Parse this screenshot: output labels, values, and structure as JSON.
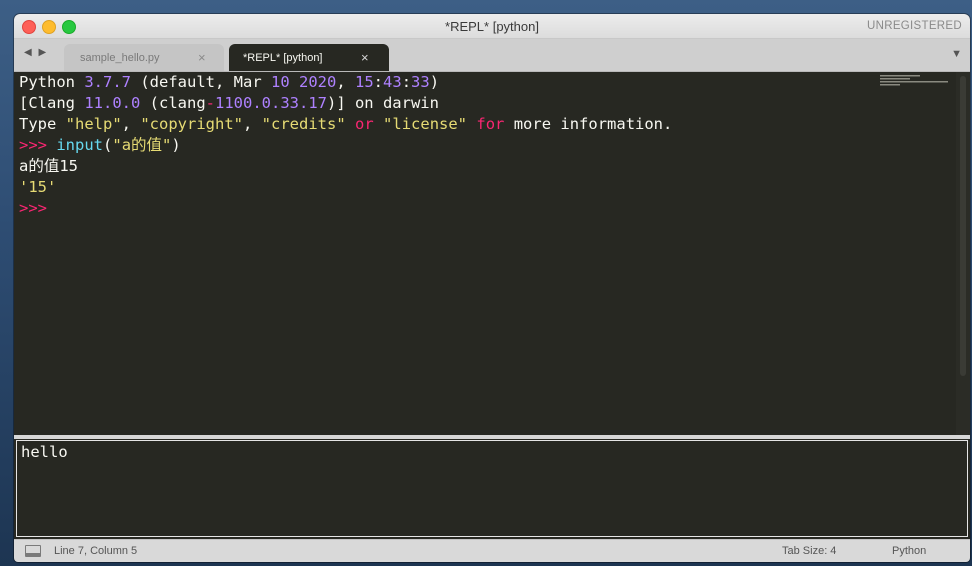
{
  "window": {
    "title": "*REPL* [python]",
    "license_label": "UNREGISTERED"
  },
  "tabs": {
    "nav_arrows": "◀ ▶",
    "items": [
      {
        "label": "sample_hello.py",
        "close": "×",
        "active": false
      },
      {
        "label": "*REPL* [python]",
        "close": "×",
        "active": true
      }
    ],
    "dropdown_icon": "▼"
  },
  "editor": {
    "lines": [
      [
        {
          "t": "Python ",
          "c": ""
        },
        {
          "t": "3.7.7",
          "c": "num"
        },
        {
          "t": " (default, Mar ",
          "c": ""
        },
        {
          "t": "10",
          "c": "num"
        },
        {
          "t": " ",
          "c": ""
        },
        {
          "t": "2020",
          "c": "num"
        },
        {
          "t": ", ",
          "c": ""
        },
        {
          "t": "15",
          "c": "num"
        },
        {
          "t": ":",
          "c": ""
        },
        {
          "t": "43",
          "c": "num"
        },
        {
          "t": ":",
          "c": ""
        },
        {
          "t": "33",
          "c": "num"
        },
        {
          "t": ")",
          "c": ""
        }
      ],
      [
        {
          "t": "[Clang ",
          "c": ""
        },
        {
          "t": "11.0.0",
          "c": "num"
        },
        {
          "t": " (clang",
          "c": ""
        },
        {
          "t": "-",
          "c": "kw"
        },
        {
          "t": "1100.0.33.17",
          "c": "num"
        },
        {
          "t": ")] on darwin",
          "c": ""
        }
      ],
      [
        {
          "t": "Type ",
          "c": ""
        },
        {
          "t": "\"help\"",
          "c": "str"
        },
        {
          "t": ", ",
          "c": ""
        },
        {
          "t": "\"copyright\"",
          "c": "str"
        },
        {
          "t": ", ",
          "c": ""
        },
        {
          "t": "\"credits\"",
          "c": "str"
        },
        {
          "t": " ",
          "c": ""
        },
        {
          "t": "or",
          "c": "kw"
        },
        {
          "t": " ",
          "c": ""
        },
        {
          "t": "\"license\"",
          "c": "str"
        },
        {
          "t": " ",
          "c": ""
        },
        {
          "t": "for",
          "c": "kw"
        },
        {
          "t": " more information.",
          "c": ""
        }
      ],
      [
        {
          "t": ">>>",
          "c": "kw"
        },
        {
          "t": " ",
          "c": ""
        },
        {
          "t": "input",
          "c": "fn"
        },
        {
          "t": "(",
          "c": ""
        },
        {
          "t": "\"a的值\"",
          "c": "str"
        },
        {
          "t": ")",
          "c": ""
        }
      ],
      [
        {
          "t": "a的值15",
          "c": ""
        }
      ],
      [
        {
          "t": "'15'",
          "c": "str"
        }
      ],
      [
        {
          "t": ">>>",
          "c": "kw"
        }
      ]
    ],
    "colors": {
      "num": "#ae81ff",
      "str": "#e6db74",
      "kw": "#f92672",
      "fn": "#66d9ef",
      "text": "#f8f8f2",
      "background": "#272822"
    }
  },
  "panel": {
    "text": "hello"
  },
  "status": {
    "position": "Line 7, Column 5",
    "tab_size": "Tab Size: 4",
    "syntax": "Python"
  }
}
